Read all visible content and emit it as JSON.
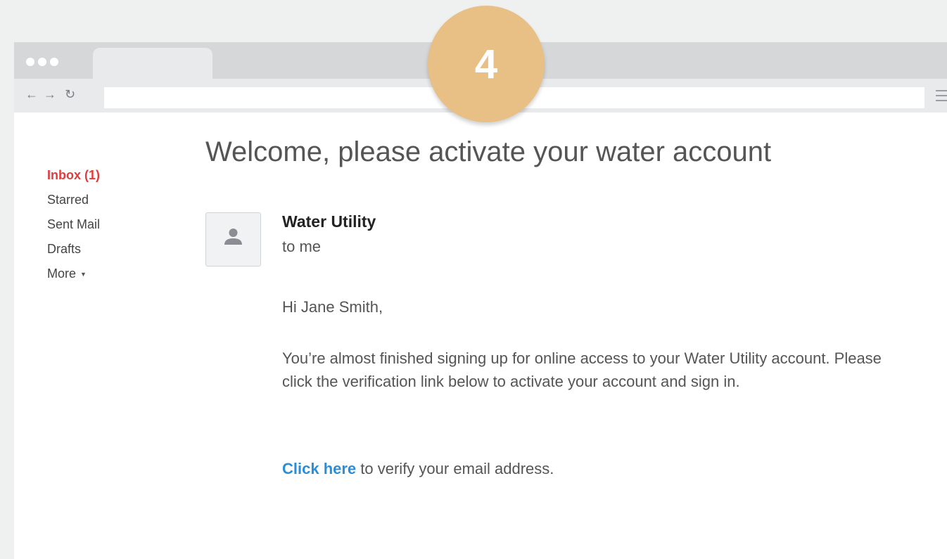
{
  "step_number": "4",
  "sidebar": {
    "items": [
      {
        "label": "Inbox (1)"
      },
      {
        "label": "Starred"
      },
      {
        "label": "Sent Mail"
      },
      {
        "label": "Drafts"
      },
      {
        "label": "More"
      }
    ]
  },
  "email": {
    "subject": "Welcome, please activate your water account",
    "sender": "Water Utility",
    "recipient": "to me",
    "greeting": "Hi Jane Smith,",
    "paragraph": "You’re almost finished signing up for online access to your Water Utility account. Please click the verification link below to activate your account and sign in.",
    "link_text": "Click here",
    "link_suffix": " to verify your email address."
  },
  "colors": {
    "active_item": "#e03c3c",
    "link": "#2a8fd8",
    "badge": "#e8bf85"
  },
  "icons": [
    "back-arrow-icon",
    "forward-arrow-icon",
    "reload-icon",
    "hamburger-menu-icon",
    "avatar-person-icon",
    "caret-down-icon"
  ]
}
